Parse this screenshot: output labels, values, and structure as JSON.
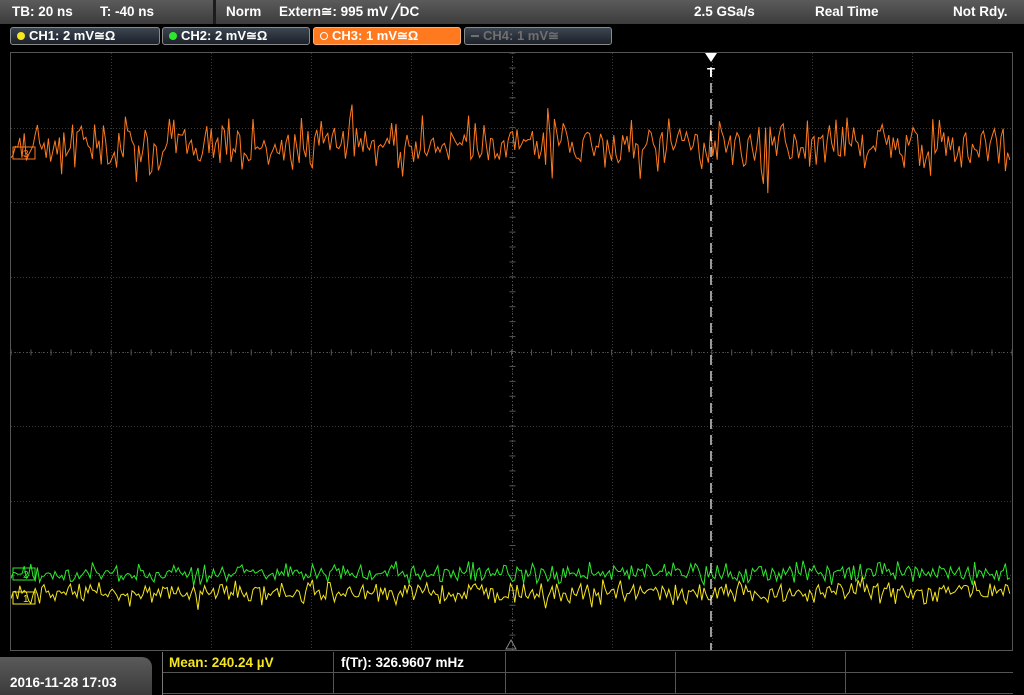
{
  "statusbar": {
    "timebase": "TB: 20 ns",
    "time_offset": "T: -40 ns",
    "trigger_mode": "Norm",
    "trigger_source": "Extern≅: 995 mV ╱DC",
    "sample_rate": "2.5 GSa/s",
    "acq_mode": "Real Time",
    "trigger_state": "Not Rdy."
  },
  "channels": [
    {
      "label": "CH1: 2 mV≅Ω",
      "color": "#f5e61e",
      "state": "on"
    },
    {
      "label": "CH2: 2 mV≅Ω",
      "color": "#2ee82e",
      "state": "on"
    },
    {
      "label": "CH3: 1 mV≅Ω",
      "color": "#ff7a1f",
      "state": "active"
    },
    {
      "label": "CH4: 1 mV≅",
      "color": "#6f6f6f",
      "state": "off"
    }
  ],
  "markers": {
    "trigger_label": "T",
    "ch3_ref": "3",
    "ch2_ref": "2",
    "ch1_ref": "1"
  },
  "bottom": {
    "datetime": "2016-11-28 17:03",
    "measurements": [
      {
        "label": "Mean: 240.24 µV",
        "color": "#f5e61e"
      },
      {
        "label": "f(Tr): 326.9607 mHz",
        "color": "#ffffff"
      }
    ]
  },
  "colors": {
    "ch1": "#f5e61e",
    "ch2": "#2ee82e",
    "ch3": "#ff7a1f",
    "grid": "#3a3a3a",
    "trigger_line": "#ffffff"
  }
}
